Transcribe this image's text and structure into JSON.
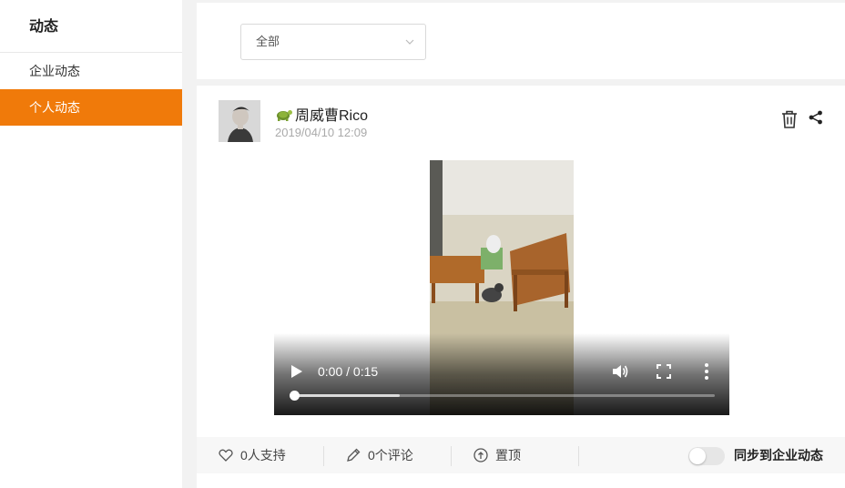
{
  "sidebar": {
    "title": "动态",
    "items": [
      {
        "label": "企业动态",
        "active": false
      },
      {
        "label": "个人动态",
        "active": true
      }
    ]
  },
  "filter": {
    "selected": "全部"
  },
  "post": {
    "author": "周威曹Rico",
    "author_emoji": "turtle-emoji",
    "time": "2019/04/10 12:09",
    "video": {
      "current_time": "0:00",
      "separator": "/",
      "duration": "0:15",
      "progress_fraction": 0.0,
      "buffered_fraction": 0.25
    }
  },
  "actions": {
    "like": "0人支持",
    "comment": "0个评论",
    "pin": "置顶",
    "sync_label": "同步到企业动态",
    "sync_on": false
  },
  "colors": {
    "accent": "#f07a0a",
    "background": "#f2f2f2"
  }
}
